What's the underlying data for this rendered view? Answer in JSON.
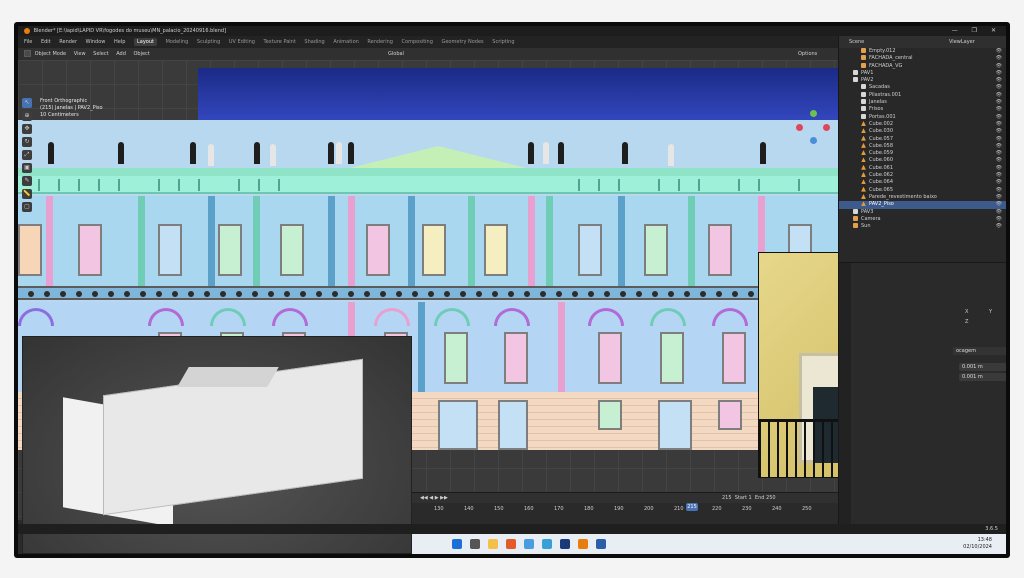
{
  "window": {
    "title": "Blender* [E:\\lapid\\LAPID VR\\fogodes do museu\\MN_palacio_20240916.blend]",
    "controls": "— ❐ ✕"
  },
  "menu": {
    "items": [
      "File",
      "Edit",
      "Render",
      "Window",
      "Help"
    ],
    "workspaces": [
      "Layout",
      "Modeling",
      "Sculpting",
      "UV Editing",
      "Texture Paint",
      "Shading",
      "Animation",
      "Rendering",
      "Compositing",
      "Geometry Nodes",
      "Scripting"
    ],
    "active_workspace": "Layout",
    "scene": "Scene",
    "viewlayer": "ViewLayer"
  },
  "viewport_header": {
    "mode": "Object Mode",
    "items": [
      "View",
      "Select",
      "Add",
      "Object"
    ],
    "transform": "Global",
    "options": "Options"
  },
  "viewport_info": {
    "line1": "Front Orthographic",
    "line2": "(215) Janelas | PAV2_Piso",
    "line3": "10 Centimeters"
  },
  "outliner": {
    "rows": [
      {
        "name": "Empty.012",
        "type": "empty",
        "indent": 2
      },
      {
        "name": "FACHADA_central",
        "type": "empty",
        "indent": 2
      },
      {
        "name": "FACHADA_VG",
        "type": "empty",
        "indent": 2
      },
      {
        "name": "PAV1",
        "type": "coll",
        "indent": 1
      },
      {
        "name": "PAV2",
        "type": "coll",
        "indent": 1
      },
      {
        "name": "Sacadas",
        "type": "coll",
        "indent": 2
      },
      {
        "name": "Pilastras.001",
        "type": "coll",
        "indent": 2
      },
      {
        "name": "Janelas",
        "type": "coll",
        "indent": 2
      },
      {
        "name": "Frisos",
        "type": "coll",
        "indent": 2
      },
      {
        "name": "Portas.001",
        "type": "coll",
        "indent": 2
      },
      {
        "name": "Cube.002",
        "type": "mesh",
        "indent": 2
      },
      {
        "name": "Cube.030",
        "type": "mesh",
        "indent": 2
      },
      {
        "name": "Cube.057",
        "type": "mesh",
        "indent": 2
      },
      {
        "name": "Cube.058",
        "type": "mesh",
        "indent": 2
      },
      {
        "name": "Cube.059",
        "type": "mesh",
        "indent": 2
      },
      {
        "name": "Cube.060",
        "type": "mesh",
        "indent": 2
      },
      {
        "name": "Cube.061",
        "type": "mesh",
        "indent": 2
      },
      {
        "name": "Cube.062",
        "type": "mesh",
        "indent": 2
      },
      {
        "name": "Cube.064",
        "type": "mesh",
        "indent": 2
      },
      {
        "name": "Cube.065",
        "type": "mesh",
        "indent": 2
      },
      {
        "name": "Parede_revestimento baixo",
        "type": "mesh",
        "indent": 2
      },
      {
        "name": "PAV2_Piso",
        "type": "mesh",
        "indent": 2,
        "selected": true
      },
      {
        "name": "PAV3",
        "type": "coll",
        "indent": 1
      },
      {
        "name": "Camera",
        "type": "empty",
        "indent": 1
      },
      {
        "name": "Sun",
        "type": "empty",
        "indent": 1
      }
    ]
  },
  "properties": {
    "header": "ocagem",
    "field1": "0.001 m",
    "field2": "0.001 m",
    "x": "X",
    "y": "Y",
    "z": "Z"
  },
  "timeline": {
    "frame": "215",
    "start_label": "Start",
    "start": "1",
    "end_label": "End",
    "end": "250",
    "ticks": [
      "130",
      "140",
      "150",
      "160",
      "170",
      "180",
      "190",
      "200",
      "210",
      "220",
      "230",
      "240",
      "250"
    ]
  },
  "status": {
    "version": "3.6.5"
  },
  "taskbar": {
    "time": "13:48",
    "date": "02/10/2024"
  },
  "colors": {
    "accent": "#4772b3",
    "blender_orange": "#e87d0d"
  }
}
